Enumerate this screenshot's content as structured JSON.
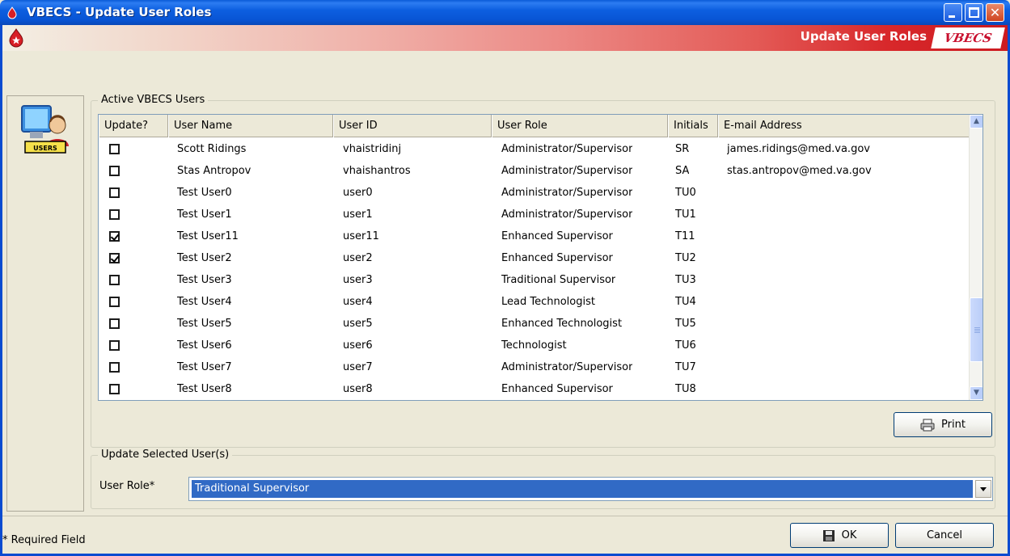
{
  "window": {
    "title": "VBECS - Update User Roles",
    "controls": [
      "minimize",
      "maximize",
      "close"
    ]
  },
  "banner": {
    "title": "Update User Roles",
    "brand": "VBECS"
  },
  "side_panel": {
    "icon": "users-icon",
    "icon_label": "USERS"
  },
  "users_group": {
    "legend": "Active VBECS Users",
    "columns": [
      "Update?",
      "User Name",
      "User ID",
      "User Role",
      "Initials",
      "E-mail Address"
    ],
    "rows": [
      {
        "checked": false,
        "name": "Scott Ridings",
        "id": "vhaistridinj",
        "role": "Administrator/Supervisor",
        "initials": "SR",
        "email": "james.ridings@med.va.gov"
      },
      {
        "checked": false,
        "name": "Stas Antropov",
        "id": "vhaishantros",
        "role": "Administrator/Supervisor",
        "initials": "SA",
        "email": "stas.antropov@med.va.gov"
      },
      {
        "checked": false,
        "name": "Test User0",
        "id": "user0",
        "role": "Administrator/Supervisor",
        "initials": "TU0",
        "email": ""
      },
      {
        "checked": false,
        "name": "Test User1",
        "id": "user1",
        "role": "Administrator/Supervisor",
        "initials": "TU1",
        "email": ""
      },
      {
        "checked": true,
        "name": "Test User11",
        "id": "user11",
        "role": "Enhanced Supervisor",
        "initials": "T11",
        "email": ""
      },
      {
        "checked": true,
        "name": "Test User2",
        "id": "user2",
        "role": "Enhanced Supervisor",
        "initials": "TU2",
        "email": ""
      },
      {
        "checked": false,
        "name": "Test User3",
        "id": "user3",
        "role": "Traditional Supervisor",
        "initials": "TU3",
        "email": ""
      },
      {
        "checked": false,
        "name": "Test User4",
        "id": "user4",
        "role": "Lead Technologist",
        "initials": "TU4",
        "email": ""
      },
      {
        "checked": false,
        "name": "Test User5",
        "id": "user5",
        "role": "Enhanced Technologist",
        "initials": "TU5",
        "email": ""
      },
      {
        "checked": false,
        "name": "Test User6",
        "id": "user6",
        "role": "Technologist",
        "initials": "TU6",
        "email": ""
      },
      {
        "checked": false,
        "name": "Test User7",
        "id": "user7",
        "role": "Administrator/Supervisor",
        "initials": "TU7",
        "email": ""
      },
      {
        "checked": false,
        "name": "Test User8",
        "id": "user8",
        "role": "Enhanced Supervisor",
        "initials": "TU8",
        "email": ""
      }
    ],
    "print_label": "Print"
  },
  "update_group": {
    "legend": "Update Selected User(s)",
    "role_label": "User Role*",
    "role_value": "Traditional Supervisor"
  },
  "footer": {
    "required_note": "* Required Field",
    "ok_label": "OK",
    "cancel_label": "Cancel"
  },
  "colors": {
    "titlebar": "#0a5bd8",
    "selection": "#316ac5",
    "banner_red": "#cc1a20"
  }
}
